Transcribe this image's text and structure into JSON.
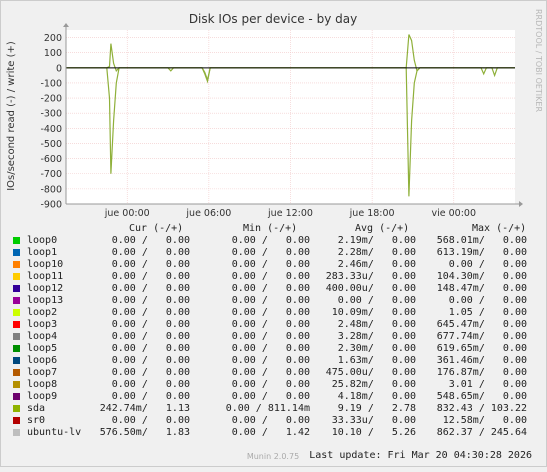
{
  "title": "Disk IOs per device - by day",
  "ylabel": "IOs/second read (-) / write (+)",
  "watermark": "RRDTOOL / TOBI OETIKER",
  "footer": "Munin 2.0.75",
  "last_update": "Last update: Fri Mar 20 04:30:28 2026",
  "headers": {
    "cur": "Cur (-/+)",
    "min": "Min (-/+)",
    "avg": "Avg (-/+)",
    "max": "Max (-/+)"
  },
  "chart_data": {
    "type": "line",
    "title": "Disk IOs per device - by day",
    "ylabel": "IOs/second read (-) / write (+)",
    "ylim": [
      -900,
      250
    ],
    "yticks": [
      200,
      100,
      0,
      -100,
      -200,
      -300,
      -400,
      -500,
      -600,
      -700,
      -800,
      -900
    ],
    "ytick_labels": [
      "200",
      "100",
      "0",
      "-100",
      "-200",
      "-300",
      "-400",
      "-500",
      "-600",
      "-700",
      "-800",
      "-900"
    ],
    "xlim": [
      -4.5,
      28.5
    ],
    "x_unit": "hours since jue 00:00",
    "xticks": [
      0,
      6,
      12,
      18,
      24
    ],
    "xtick_labels": [
      "jue 00:00",
      "jue 06:00",
      "jue 12:00",
      "jue 18:00",
      "vie 00:00"
    ],
    "grid": true,
    "series": [
      {
        "name": "sda",
        "color": "#8fb03a",
        "write": [
          [
            -4.5,
            0
          ],
          [
            -1.5,
            0
          ],
          [
            -1.3,
            8
          ],
          [
            -1.2,
            160
          ],
          [
            -1.0,
            30
          ],
          [
            -0.8,
            -20
          ],
          [
            -0.6,
            0
          ],
          [
            3.0,
            0
          ],
          [
            3.2,
            -20
          ],
          [
            3.4,
            0
          ],
          [
            5.5,
            0
          ],
          [
            5.7,
            -40
          ],
          [
            5.9,
            -90
          ],
          [
            6.1,
            0
          ],
          [
            20.5,
            0
          ],
          [
            20.7,
            220
          ],
          [
            20.9,
            180
          ],
          [
            21.1,
            50
          ],
          [
            21.3,
            -20
          ],
          [
            21.5,
            0
          ],
          [
            26.0,
            0
          ],
          [
            26.2,
            -40
          ],
          [
            26.4,
            0
          ],
          [
            26.8,
            0
          ],
          [
            27.0,
            -50
          ],
          [
            27.2,
            0
          ],
          [
            28.5,
            0
          ]
        ],
        "read": [
          [
            -4.5,
            0
          ],
          [
            -1.5,
            0
          ],
          [
            -1.3,
            -200
          ],
          [
            -1.2,
            -700
          ],
          [
            -1.0,
            -350
          ],
          [
            -0.8,
            -100
          ],
          [
            -0.6,
            0
          ],
          [
            5.5,
            0
          ],
          [
            5.7,
            -30
          ],
          [
            5.9,
            -80
          ],
          [
            6.1,
            0
          ],
          [
            20.5,
            0
          ],
          [
            20.7,
            -850
          ],
          [
            20.9,
            -350
          ],
          [
            21.1,
            -100
          ],
          [
            21.3,
            -20
          ],
          [
            21.5,
            0
          ],
          [
            28.5,
            0
          ]
        ]
      }
    ],
    "legend": [
      {
        "name": "loop0",
        "color": "#00cc00",
        "cur": "0.00 /   0.00",
        "min": "0.00 /   0.00",
        "avg": "2.19m/   0.00",
        "max": "568.01m/   0.00"
      },
      {
        "name": "loop1",
        "color": "#0066b3",
        "cur": "0.00 /   0.00",
        "min": "0.00 /   0.00",
        "avg": "2.28m/   0.00",
        "max": "613.19m/   0.00"
      },
      {
        "name": "loop10",
        "color": "#ff8000",
        "cur": "0.00 /   0.00",
        "min": "0.00 /   0.00",
        "avg": "2.46m/   0.00",
        "max": "0.00 /   0.00"
      },
      {
        "name": "loop11",
        "color": "#ffcc00",
        "cur": "0.00 /   0.00",
        "min": "0.00 /   0.00",
        "avg": "283.33u/   0.00",
        "max": "104.30m/   0.00"
      },
      {
        "name": "loop12",
        "color": "#330099",
        "cur": "0.00 /   0.00",
        "min": "0.00 /   0.00",
        "avg": "400.00u/   0.00",
        "max": "148.47m/   0.00"
      },
      {
        "name": "loop13",
        "color": "#990099",
        "cur": "0.00 /   0.00",
        "min": "0.00 /   0.00",
        "avg": "0.00 /   0.00",
        "max": "0.00 /   0.00"
      },
      {
        "name": "loop2",
        "color": "#ccff00",
        "cur": "0.00 /   0.00",
        "min": "0.00 /   0.00",
        "avg": "10.09m/   0.00",
        "max": "1.05 /   0.00"
      },
      {
        "name": "loop3",
        "color": "#ff0000",
        "cur": "0.00 /   0.00",
        "min": "0.00 /   0.00",
        "avg": "2.48m/   0.00",
        "max": "645.47m/   0.00"
      },
      {
        "name": "loop4",
        "color": "#808080",
        "cur": "0.00 /   0.00",
        "min": "0.00 /   0.00",
        "avg": "3.28m/   0.00",
        "max": "677.74m/   0.00"
      },
      {
        "name": "loop5",
        "color": "#008f00",
        "cur": "0.00 /   0.00",
        "min": "0.00 /   0.00",
        "avg": "2.30m/   0.00",
        "max": "619.65m/   0.00"
      },
      {
        "name": "loop6",
        "color": "#00487d",
        "cur": "0.00 /   0.00",
        "min": "0.00 /   0.00",
        "avg": "1.63m/   0.00",
        "max": "361.46m/   0.00"
      },
      {
        "name": "loop7",
        "color": "#b35a00",
        "cur": "0.00 /   0.00",
        "min": "0.00 /   0.00",
        "avg": "475.00u/   0.00",
        "max": "176.87m/   0.00"
      },
      {
        "name": "loop8",
        "color": "#b38f00",
        "cur": "0.00 /   0.00",
        "min": "0.00 /   0.00",
        "avg": "25.82m/   0.00",
        "max": "3.01 /   0.00"
      },
      {
        "name": "loop9",
        "color": "#6b006b",
        "cur": "0.00 /   0.00",
        "min": "0.00 /   0.00",
        "avg": "4.18m/   0.00",
        "max": "548.65m/   0.00"
      },
      {
        "name": "sda",
        "color": "#8fb300",
        "cur": "242.74m/   1.13",
        "min": "0.00 / 811.14m",
        "avg": "9.19 /   2.78",
        "max": "832.43 / 103.22"
      },
      {
        "name": "sr0",
        "color": "#b30000",
        "cur": "0.00 /   0.00",
        "min": "0.00 /   0.00",
        "avg": "33.33u/   0.00",
        "max": "12.58m/   0.00"
      },
      {
        "name": "ubuntu-lv",
        "color": "#bebebe",
        "cur": "576.50m/   1.83",
        "min": "0.00 /   1.42",
        "avg": "10.10 /   5.26",
        "max": "862.37 / 245.64"
      }
    ]
  }
}
